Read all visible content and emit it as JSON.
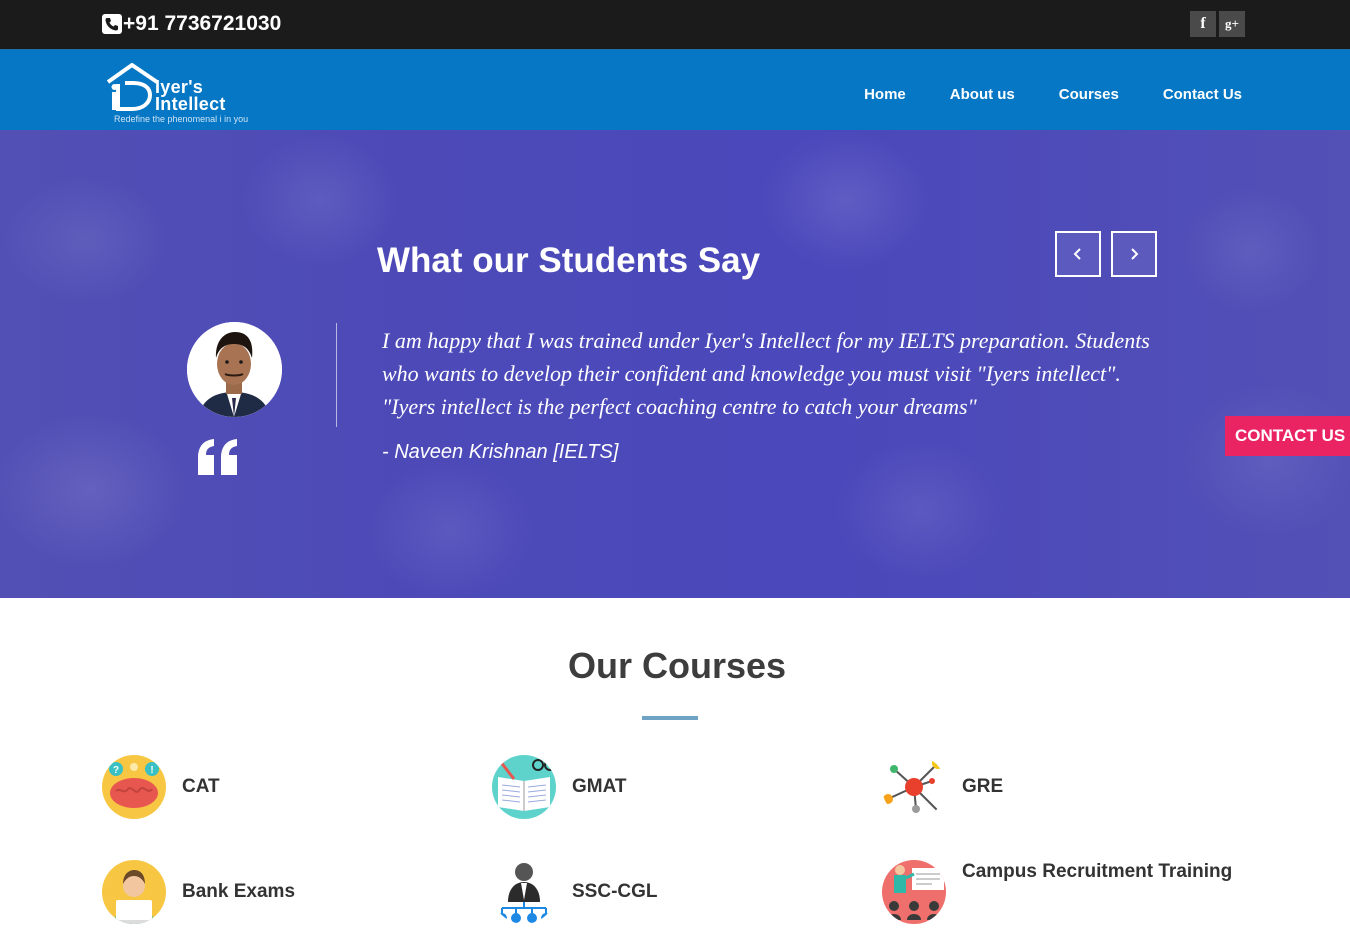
{
  "topbar": {
    "phone": "+91 7736721030",
    "social": [
      {
        "icon": "facebook-icon",
        "glyph": "f"
      },
      {
        "icon": "google-plus-icon",
        "glyph": "g+"
      }
    ]
  },
  "logo": {
    "line1": "Iyer's",
    "line2": "Intellect",
    "tagline": "Redefine the phenomenal i in you"
  },
  "nav": {
    "items": [
      "Home",
      "About us",
      "Courses",
      "Contact Us"
    ]
  },
  "testimonials": {
    "title": "What our Students Say",
    "quote": "I am happy that I was trained under Iyer's Intellect for my IELTS preparation. Students who wants to develop their confident and knowledge you must visit \"Iyers intellect\". \"Iyers intellect is the perfect coaching centre to catch your dreams\"",
    "author": "- Naveen Krishnan [IELTS]"
  },
  "contact_float": "CONTACT US",
  "courses": {
    "title": "Our Courses",
    "items": [
      "CAT",
      "GMAT",
      "GRE",
      "Bank Exams",
      "SSC-CGL",
      "Campus Recruitment Training"
    ]
  },
  "colors": {
    "topbar": "#1b1b1b",
    "navbar": "#0677c4",
    "hero_overlay": "#4d4ab8",
    "contact_button": "#ea2463",
    "underline": "#6fa3c4"
  }
}
